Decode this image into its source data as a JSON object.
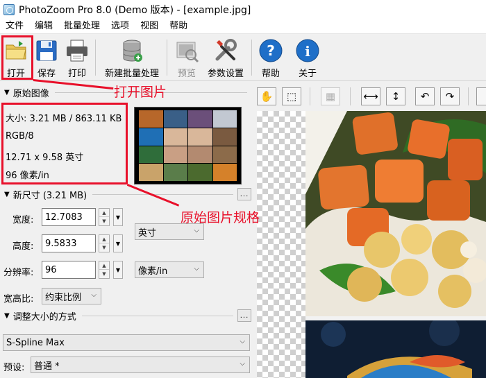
{
  "window": {
    "title": "PhotoZoom Pro 8.0 (Demo 版本) - [example.jpg]"
  },
  "menu": [
    "文件",
    "编辑",
    "批量处理",
    "选项",
    "视图",
    "帮助"
  ],
  "toolbar": {
    "open": "打开",
    "save": "保存",
    "print": "打印",
    "new_batch": "新建批量处理",
    "preview": "预览",
    "parameters": "参数设置",
    "help": "帮助",
    "about": "关于"
  },
  "original": {
    "header": "原始图像",
    "size": "大小: 3.21 MB / 863.11 KB",
    "mode": "RGB/8",
    "dimensions": "12.71 x 9.58 英寸",
    "resolution": "96 像素/in"
  },
  "new_size": {
    "header": "新尺寸 (3.21 MB)",
    "width_label": "宽度:",
    "width_value": "12.7083",
    "height_label": "高度:",
    "height_value": "9.5833",
    "resolution_label": "分辨率:",
    "resolution_value": "96",
    "size_unit": "英寸",
    "resolution_unit": "像素/in",
    "aspect_label": "宽高比:",
    "aspect_value": "约束比例"
  },
  "resize_method": {
    "header": "调整大小的方式",
    "method": "S-Spline Max",
    "preset_label": "预设:",
    "preset_value": "普通 *"
  },
  "annotations": {
    "open_image": "打开图片",
    "original_spec": "原始图片规格"
  },
  "colors": {
    "annotation_red": "#e8102a",
    "help_blue": "#1f6fc8"
  }
}
